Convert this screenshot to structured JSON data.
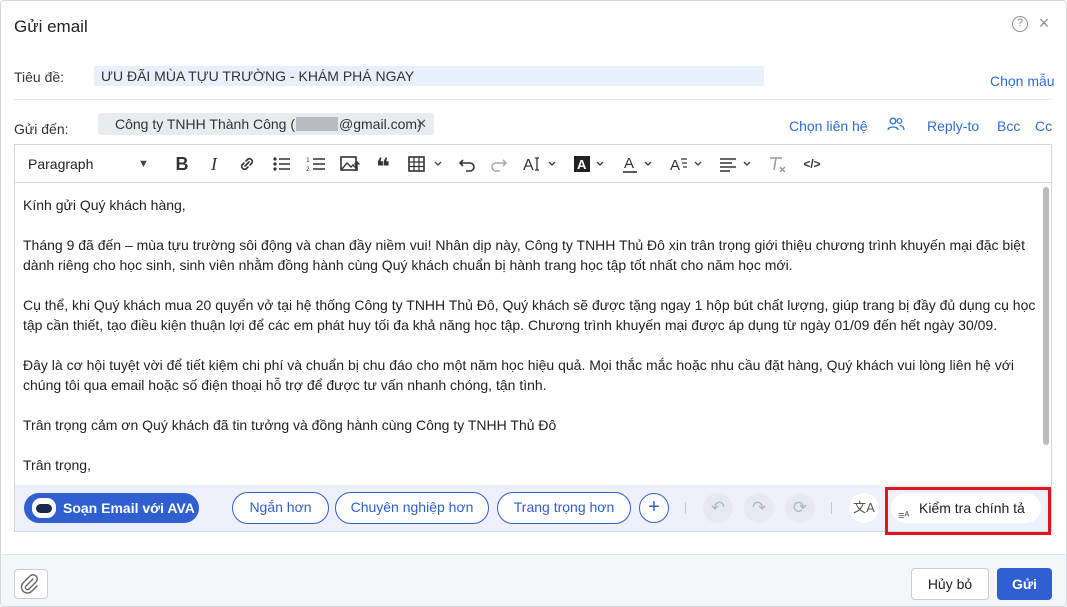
{
  "dialog": {
    "title": "Gửi email"
  },
  "subject": {
    "label": "Tiêu đề:",
    "value": "ƯU ĐÃI MÙA TỰU TRƯỜNG - KHÁM PHÁ NGAY",
    "template_link": "Chọn mẫu"
  },
  "recipients": {
    "label": "Gửi đến:",
    "chip_prefix": "Công ty TNHH Thành Công (",
    "chip_suffix": "@gmail.com)",
    "remove": "✕",
    "contacts_link": "Chọn liên hệ",
    "reply_to_link": "Reply-to",
    "bcc_link": "Bcc",
    "cc_link": "Cc"
  },
  "toolbar": {
    "paragraph": "Paragraph",
    "icons": [
      "bold-icon",
      "italic-icon",
      "link-icon",
      "bullet-list-icon",
      "numbered-list-icon",
      "image-icon",
      "quote-icon",
      "table-icon",
      "undo-icon",
      "redo-icon",
      "font-size-icon",
      "highlight-color-icon",
      "font-color-icon",
      "text-style-icon",
      "align-icon",
      "clear-format-icon",
      "source-code-icon"
    ]
  },
  "body": {
    "paragraphs": [
      "Kính gửi Quý khách hàng,",
      "Tháng 9 đã đến – mùa tựu trường sôi động và chan đầy niềm vui! Nhân dịp này, Công ty TNHH Thủ Đô xin trân trọng giới thiệu chương trình khuyến mại đặc biệt dành riêng cho học sinh, sinh viên nhằm đồng hành cùng Quý khách chuẩn bị hành trang học tập tốt nhất cho năm học mới.",
      "Cụ thể, khi Quý khách mua 20 quyển vở tại hệ thống Công ty TNHH Thủ Đô, Quý khách sẽ được tặng ngay 1 hộp bút chất lượng, giúp trang bị đầy đủ dụng cụ học tập cần thiết, tạo điều kiện thuận lợi để các em phát huy tối đa khả năng học tập. Chương trình khuyến mại được áp dụng từ ngày 01/09 đến hết ngày 30/09.",
      "Đây là cơ hội tuyệt vời để tiết kiệm chi phí và chuẩn bị chu đáo cho một năm học hiệu quả. Mọi thắc mắc hoặc nhu cầu đặt hàng, Quý khách vui lòng liên hệ với chúng tôi qua email hoặc số điện thoại hỗ trợ để được tư vấn nhanh chóng, tận tình.",
      "Trân trọng cảm ơn Quý khách đã tin tưởng và đồng hành cùng Công ty TNHH Thủ Đô",
      "Trân trọng,"
    ]
  },
  "ai_bar": {
    "ava_button": "Soạn Email với AVA",
    "shorter": "Ngắn hơn",
    "professional": "Chuyên nghiệp hơn",
    "formal": "Trang trọng hơn",
    "plus": "+",
    "spellcheck": "Kiểm tra chính tả"
  },
  "footer": {
    "cancel": "Hủy bỏ",
    "send": "Gửi"
  },
  "colors": {
    "accent": "#2f5fd0",
    "highlight_box": "#e0161e"
  }
}
